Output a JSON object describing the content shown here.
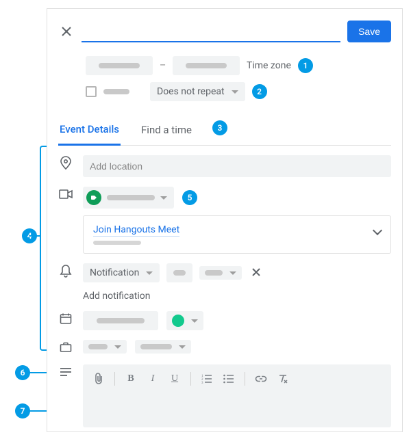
{
  "header": {
    "title_placeholder": "",
    "save_label": "Save"
  },
  "dates": {
    "timezone_label": "Time zone"
  },
  "repeat": {
    "repeat_label": "Does not repeat"
  },
  "tabs": {
    "details": "Event Details",
    "find_time": "Find a time"
  },
  "location": {
    "placeholder": "Add location"
  },
  "conferencing": {
    "join_label": "Join Hangouts Meet"
  },
  "notifications": {
    "type_label": "Notification",
    "add_label": "Add notification"
  },
  "callouts": {
    "c1": "1",
    "c2": "2",
    "c3": "3",
    "c4": "4",
    "c5": "5",
    "c6": "6",
    "c7": "7"
  }
}
